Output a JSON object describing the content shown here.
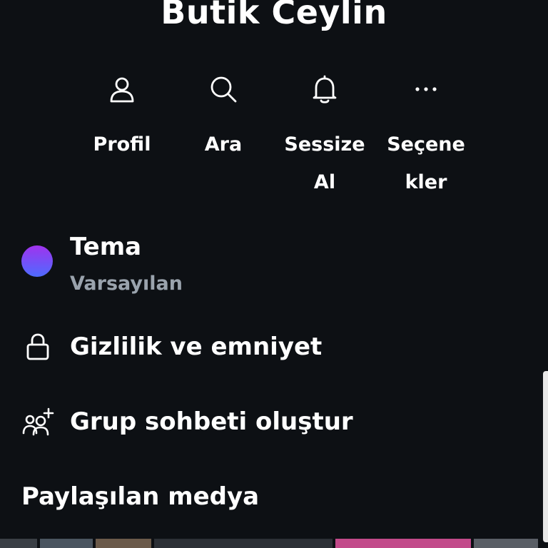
{
  "header": {
    "title": "Butik Ceylin"
  },
  "actions": [
    {
      "icon": "user-icon",
      "label": "Profil"
    },
    {
      "icon": "search-icon",
      "label": "Ara"
    },
    {
      "icon": "bell-icon",
      "label": "Sessize Al"
    },
    {
      "icon": "more-icon",
      "label": "Seçene kler"
    }
  ],
  "menu": {
    "theme": {
      "title": "Tema",
      "subtitle": "Varsayılan",
      "gradient": [
        "#a033ee",
        "#4e6bff"
      ]
    },
    "privacy": {
      "icon": "lock-icon",
      "label": "Gizlilik ve emniyet"
    },
    "group": {
      "icon": "add-group-icon",
      "label": "Grup sohbeti oluştur"
    },
    "media": {
      "label": "Paylaşılan medya"
    }
  },
  "colors": {
    "background": "#0d1014",
    "text": "#ffffff",
    "secondary_text": "#9aa3ad"
  }
}
